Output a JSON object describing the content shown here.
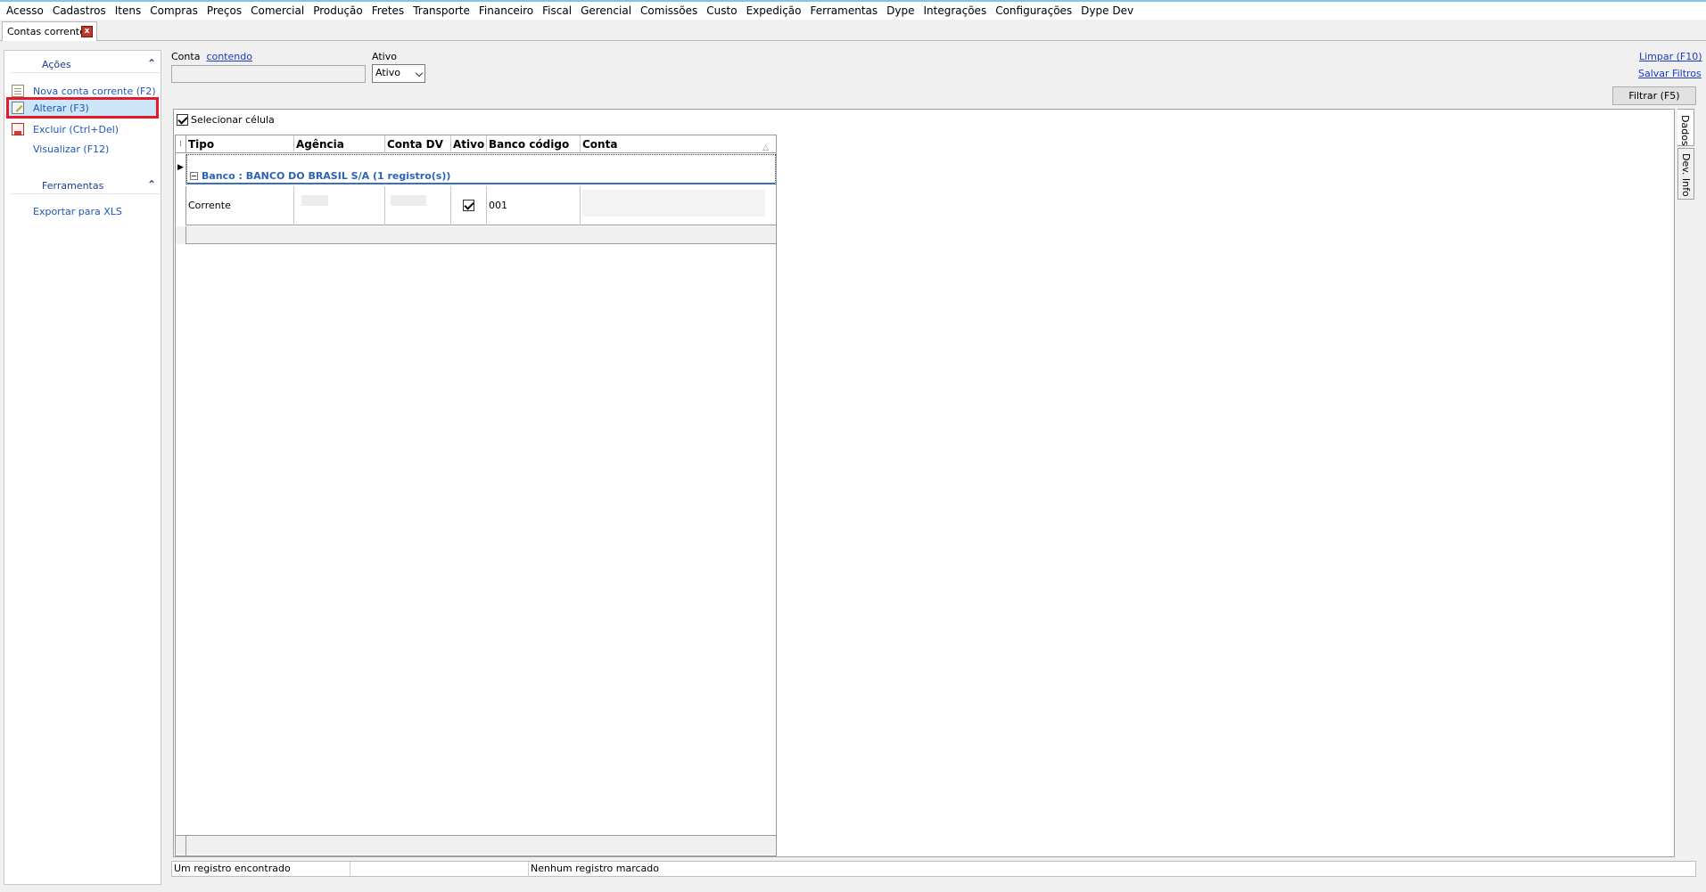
{
  "menu": [
    "Acesso",
    "Cadastros",
    "Itens",
    "Compras",
    "Preços",
    "Comercial",
    "Produção",
    "Fretes",
    "Transporte",
    "Financeiro",
    "Fiscal",
    "Gerencial",
    "Comissões",
    "Custo",
    "Expedição",
    "Ferramentas",
    "Dype",
    "Integrações",
    "Configurações",
    "Dype Dev"
  ],
  "tab": {
    "label": "Contas corrente",
    "close_glyph": "x"
  },
  "left": {
    "acoes_title": "Ações",
    "actions": [
      {
        "label": "Nova conta corrente (F2)",
        "icon": "document-new-icon"
      },
      {
        "label": "Alterar (F3)",
        "icon": "edit-icon"
      },
      {
        "label": "Excluir (Ctrl+Del)",
        "icon": "delete-icon"
      },
      {
        "label": "Visualizar (F12)",
        "icon": ""
      }
    ],
    "ferramentas_title": "Ferramentas",
    "tools": [
      {
        "label": "Exportar para XLS"
      }
    ],
    "collapse_glyph": "⌃"
  },
  "filters": {
    "conta_label": "Conta",
    "conta_mode": "contendo",
    "conta_value": "",
    "ativo_label": "Ativo",
    "ativo_value": "Ativo",
    "limpar": "Limpar (F10)",
    "salvar": "Salvar Filtros",
    "filtrar": "Filtrar (F5)"
  },
  "grid": {
    "selecionar_celula": "Selecionar célula",
    "selecionar_celula_checked": true,
    "columns": [
      "Tipo",
      "Agência",
      "Conta DV",
      "Ativo",
      "Banco código",
      "Conta"
    ],
    "group_label": "Banco : BANCO DO BRASIL S/A (1 registro(s))",
    "rows": [
      {
        "tipo": "Corrente",
        "agencia": "",
        "conta_dv": "",
        "ativo": true,
        "banco_codigo": "001",
        "conta": ""
      }
    ],
    "sort_glyph": "△",
    "header_glyph": "⁞",
    "row_pointer_glyph": "▶"
  },
  "side_tabs": [
    "Dados",
    "Dev. Info"
  ],
  "status": {
    "count": "Um registro encontrado",
    "middle": "",
    "marked": "Nenhum registro marcado"
  }
}
